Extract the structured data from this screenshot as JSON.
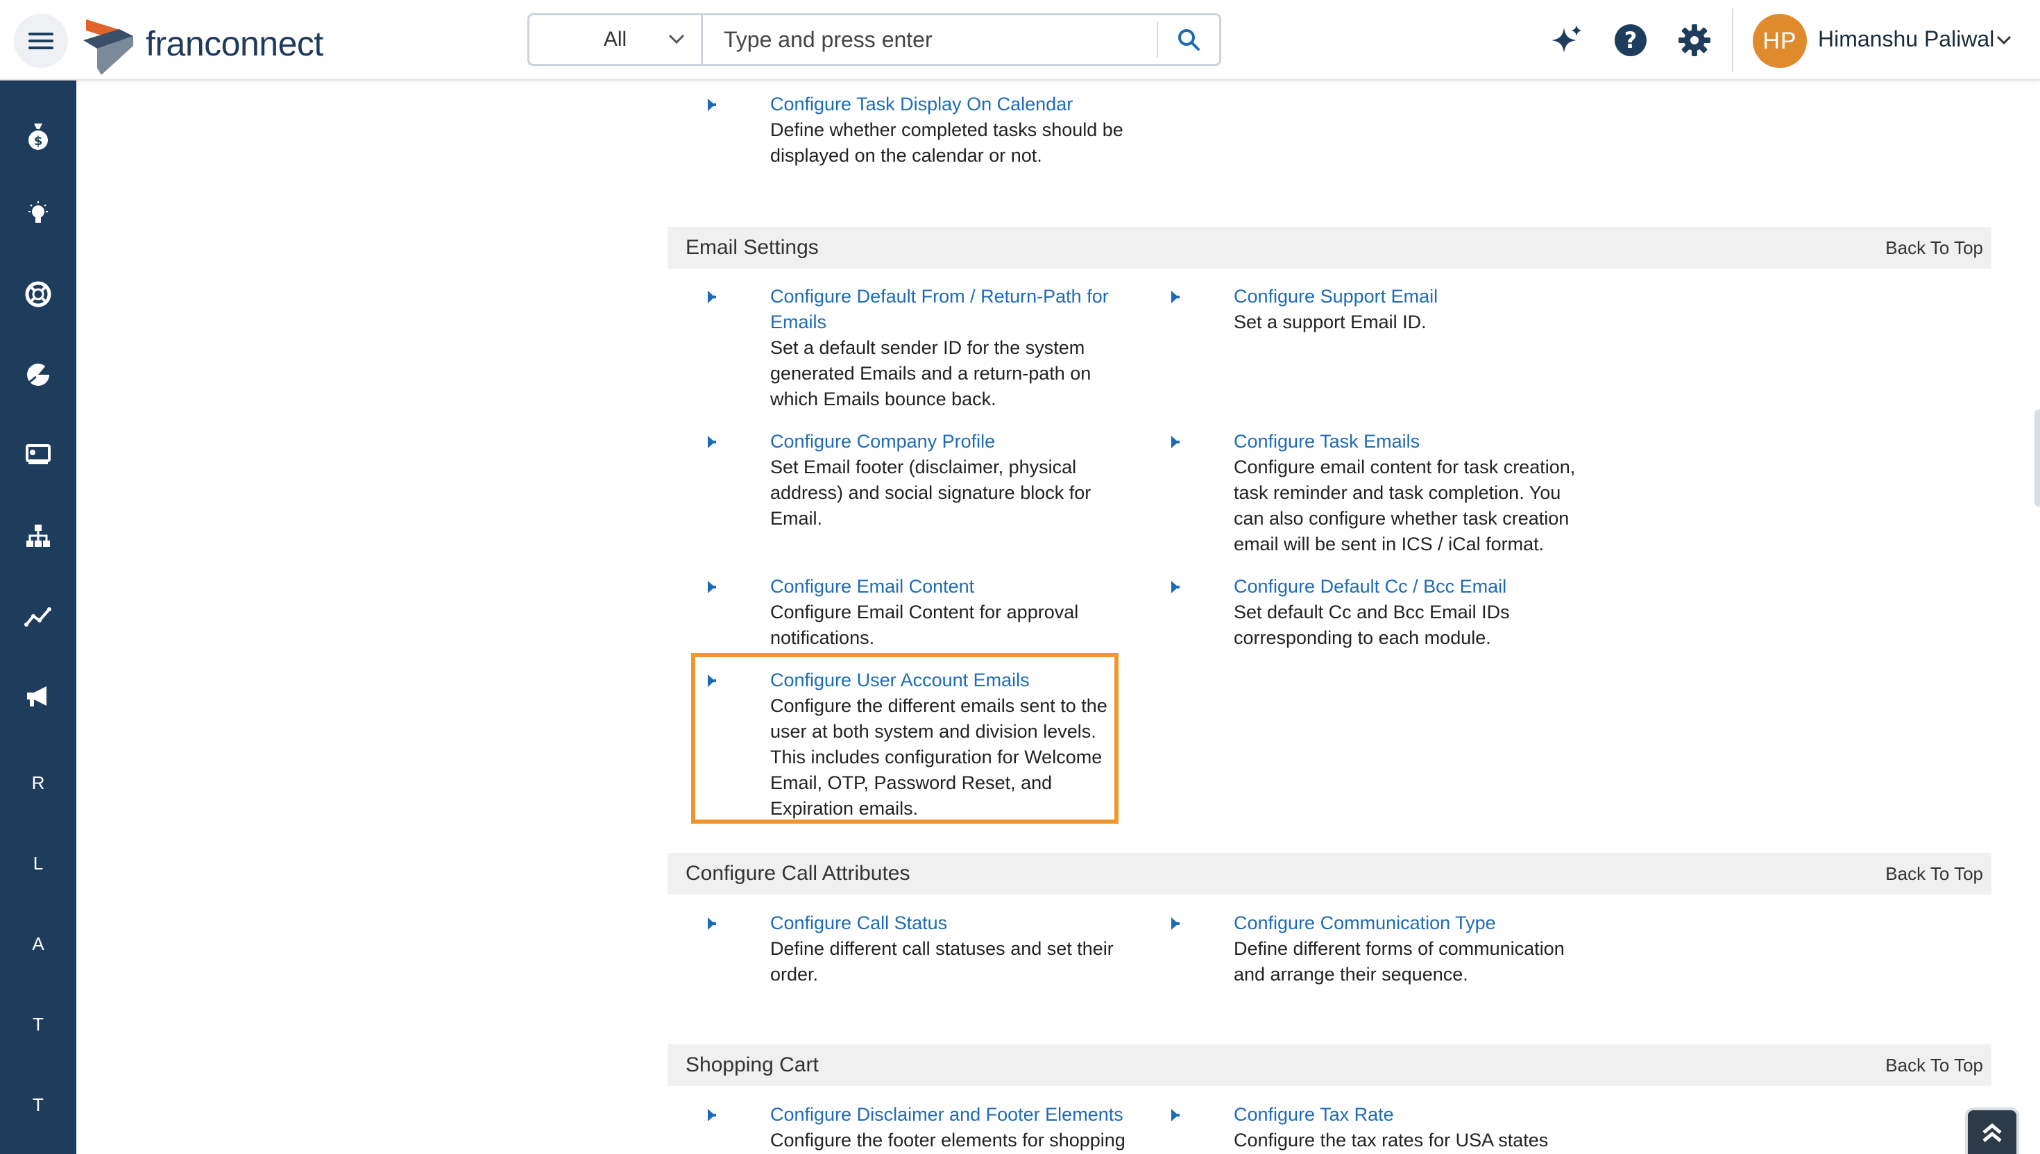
{
  "header": {
    "logo_text": "franconnect",
    "search": {
      "scope": "All",
      "placeholder": "Type and press enter"
    },
    "user": {
      "initials": "HP",
      "name": "Himanshu Paliwal"
    }
  },
  "sidebar": {
    "letters": [
      "R",
      "L",
      "A",
      "T",
      "T"
    ]
  },
  "top_item": {
    "link": "Configure Task Display On Calendar",
    "desc": "Define whether completed tasks should be displayed on the calendar or not."
  },
  "sections": [
    {
      "title": "Email Settings",
      "back": "Back To Top",
      "items": [
        {
          "link": "Configure Default From / Return-Path for Emails",
          "desc": "Set a default sender ID for the system generated Emails and a return-path on which Emails bounce back."
        },
        {
          "link": "Configure Support Email",
          "desc": "Set a support Email ID."
        },
        {
          "link": "Configure Company Profile",
          "desc": "Set Email footer (disclaimer, physical address) and social signature block for Email."
        },
        {
          "link": "Configure Task Emails",
          "desc": "Configure email content for task creation, task reminder and task completion. You can also configure whether task creation email will be sent in ICS / iCal format."
        },
        {
          "link": "Configure Email Content",
          "desc": "Configure Email Content for approval notifications."
        },
        {
          "link": "Configure Default Cc / Bcc Email",
          "desc": "Set default Cc and Bcc Email IDs corresponding to each module."
        },
        {
          "link": "Configure User Account Emails",
          "desc": "Configure the different emails sent to the user at both system and division levels. This includes configuration for Welcome Email, OTP, Password Reset, and Expiration emails."
        }
      ]
    },
    {
      "title": "Configure Call Attributes",
      "back": "Back To Top",
      "items": [
        {
          "link": "Configure Call Status",
          "desc": "Define different call statuses and set their order."
        },
        {
          "link": "Configure Communication Type",
          "desc": "Define different forms of communication and arrange their sequence."
        }
      ]
    },
    {
      "title": "Shopping Cart",
      "back": "Back To Top",
      "items": [
        {
          "link": "Configure Disclaimer and Footer Elements",
          "desc": "Configure the footer elements for shopping"
        },
        {
          "link": "Configure Tax Rate",
          "desc": "Configure the tax rates for USA states which"
        }
      ]
    }
  ],
  "colors": {
    "sidebar": "#1e3d5c",
    "link": "#1d6bb6",
    "highlight": "#f0962e",
    "avatar": "#e08a2e"
  }
}
